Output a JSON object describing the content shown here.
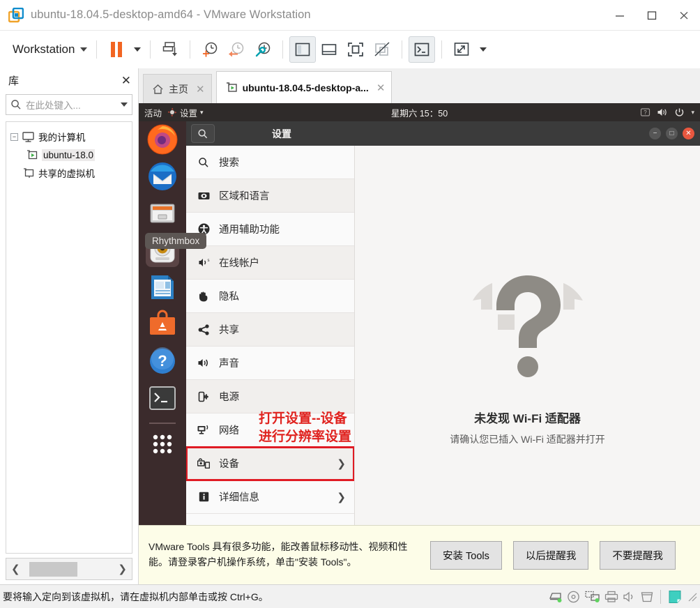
{
  "window": {
    "title": "ubuntu-18.04.5-desktop-amd64 - VMware Workstation",
    "minimize_label": "minimize",
    "maximize_label": "maximize",
    "close_label": "close"
  },
  "toolbar": {
    "workstation_label": "Workstation",
    "icons": [
      "pause-icon",
      "pause-dropdown-icon",
      "snapshot-take-icon",
      "snapshot-add-icon",
      "snapshot-revert-icon",
      "snapshot-manager-icon",
      "show-library-icon",
      "show-console-view-icon",
      "fullscreen-icon",
      "unity-mode-icon",
      "terminal-icon",
      "stretch-icon",
      "stretch-dropdown-icon"
    ]
  },
  "library": {
    "title": "库",
    "close_label": "✕",
    "search_placeholder": "在此处键入...",
    "tree": [
      {
        "label": "我的计算机",
        "icon": "computer-icon",
        "expanded": true,
        "selected": false
      },
      {
        "label": "ubuntu-18.0",
        "icon": "vm-icon",
        "indent": true,
        "selected": true
      },
      {
        "label": "共享的虚拟机",
        "icon": "shared-vm-icon",
        "indent": false,
        "selected": false
      }
    ],
    "prev_label": "❮",
    "next_label": "❯"
  },
  "tabs": [
    {
      "label": "主页",
      "icon": "home-icon",
      "active": false,
      "close": "✕"
    },
    {
      "label": "ubuntu-18.04.5-desktop-a...",
      "icon": "vm-icon",
      "active": true,
      "close": "✕"
    }
  ],
  "guest": {
    "topbar": {
      "activities": "活动",
      "app_name": "设置",
      "app_icon": "settings-app-icon",
      "clock": "星期六 15：50",
      "right_icons": [
        "keyboard-indicator-icon",
        "volume-icon",
        "power-icon",
        "chevron-down-icon"
      ]
    },
    "dock": [
      {
        "name": "firefox-icon",
        "selected": false
      },
      {
        "name": "thunderbird-icon",
        "selected": false
      },
      {
        "name": "files-icon",
        "selected": false
      },
      {
        "name": "rhythmbox-icon",
        "selected": true
      },
      {
        "name": "libreoffice-writer-icon",
        "selected": false
      },
      {
        "name": "ubuntu-software-icon",
        "selected": false
      },
      {
        "name": "help-icon",
        "selected": false
      },
      {
        "name": "terminal-icon",
        "selected": false
      },
      {
        "name": "show-applications-icon",
        "selected": false
      }
    ],
    "tooltip": "Rhythmbox",
    "settings": {
      "header_title": "设置",
      "search_icon": "search-icon",
      "window_buttons": {
        "minimize": "−",
        "maximize": "□",
        "close": "✕"
      },
      "items": [
        {
          "label": "搜索",
          "icon": "search-icon",
          "chevron": "",
          "highlight": false
        },
        {
          "label": "区域和语言",
          "icon": "region-language-icon",
          "chevron": "",
          "highlight": false
        },
        {
          "label": "通用辅助功能",
          "icon": "accessibility-icon",
          "chevron": "",
          "highlight": false
        },
        {
          "label": "在线帐户",
          "icon": "online-accounts-icon",
          "chevron": "",
          "highlight": false
        },
        {
          "label": "隐私",
          "icon": "privacy-icon",
          "chevron": "",
          "highlight": false
        },
        {
          "label": "共享",
          "icon": "sharing-icon",
          "chevron": "",
          "highlight": false
        },
        {
          "label": "声音",
          "icon": "sound-icon",
          "chevron": "",
          "highlight": false
        },
        {
          "label": "电源",
          "icon": "power-icon",
          "chevron": "",
          "highlight": false
        },
        {
          "label": "网络",
          "icon": "network-icon",
          "chevron": "",
          "highlight": false
        },
        {
          "label": "设备",
          "icon": "devices-icon",
          "chevron": "❯",
          "highlight": true
        },
        {
          "label": "详细信息",
          "icon": "details-icon",
          "chevron": "❯",
          "highlight": false
        }
      ],
      "wifi_panel": {
        "icon": "wifi-question-icon",
        "title": "未发现 Wi-Fi 适配器",
        "subtitle": "请确认您已插入 Wi-Fi 适配器并打开"
      }
    },
    "annotation": {
      "line1": "打开设置--设备",
      "line2": "进行分辨率设置",
      "color": "#e0231f"
    }
  },
  "tools_banner": {
    "message": "VMware Tools 具有很多功能，能改善鼠标移动性、视频和性能。请登录客户机操作系统，单击\"安装 Tools\"。",
    "buttons": [
      "安装 Tools",
      "以后提醒我",
      "不要提醒我"
    ]
  },
  "statusbar": {
    "message": "要将输入定向到该虚拟机，请在虚拟机内部单击或按 Ctrl+G。",
    "icons": [
      "hard-disk-icon",
      "cd-dvd-icon",
      "network-adapter-icon",
      "printer-icon",
      "sound-card-icon",
      "removable-device-icon",
      "note-icon",
      "resize-grip-icon"
    ]
  },
  "colors": {
    "accent_orange": "#f26522",
    "annotation_red": "#e0231f",
    "tools_banner_bg": "#fdfde8",
    "gnome_dark": "#3b2b2c"
  }
}
